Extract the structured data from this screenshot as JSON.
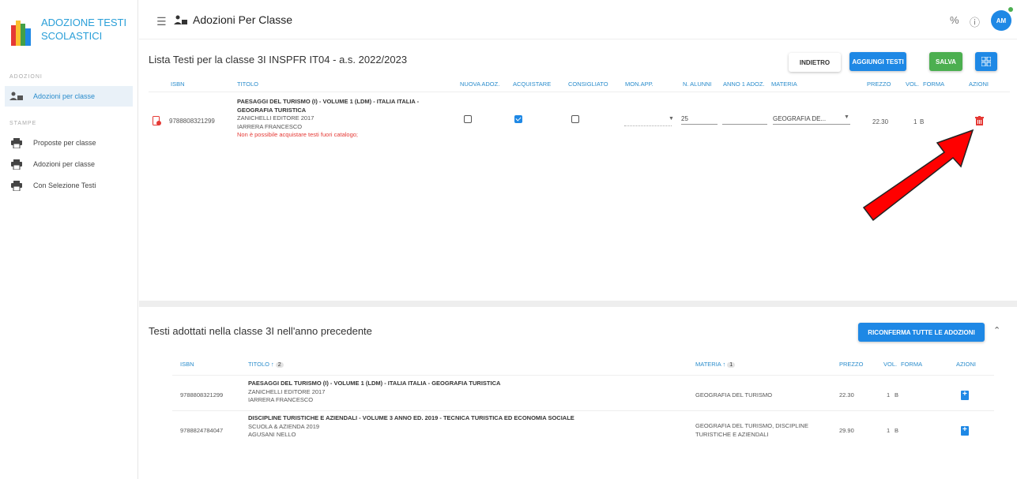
{
  "brand": {
    "name": "ADOZIONE TESTI SCOLASTICI"
  },
  "sidebar": {
    "section_adozioni": "ADOZIONI",
    "section_stampe": "STAMPE",
    "items": [
      {
        "label": "Adozioni per classe",
        "icon": "users-book-icon",
        "active": true
      },
      {
        "label": "Proposte per classe",
        "icon": "printer-icon"
      },
      {
        "label": "Adozioni per classe",
        "icon": "printer-icon"
      },
      {
        "label": "Con Selezione Testi",
        "icon": "printer-icon"
      }
    ]
  },
  "header": {
    "title": "Adozioni Per Classe",
    "avatar_initials": "AM",
    "icons": [
      "menu-icon",
      "percent-icon",
      "info-icon"
    ]
  },
  "upper": {
    "title": "Lista Testi per la classe 3I INSPFR IT04 - a.s. 2022/2023",
    "buttons": {
      "back": "INDIETRO",
      "add": "AGGIUNGI TESTI",
      "save": "SALVA"
    },
    "columns": {
      "isbn": "ISBN",
      "titolo": "TITOLO",
      "nuova": "NUOVA ADOZ.",
      "acquistare": "ACQUISTARE",
      "consigliato": "CONSIGLIATO",
      "monapp": "MON.APP.",
      "alunni": "N. ALUNNI",
      "anno": "ANNO 1 ADOZ.",
      "materia": "MATERIA",
      "prezzo": "PREZZO",
      "vol": "VOL.",
      "forma": "FORMA",
      "azioni": "AZIONI"
    },
    "row": {
      "isbn": "9788808321299",
      "title": "PAESAGGI DEL TURISMO (I) - VOLUME 1 (LDM) - ITALIA ITALIA - GEOGRAFIA TURISTICA",
      "publisher": "ZANICHELLI EDITORE 2017",
      "author": "IARRERA FRANCESCO",
      "warning": "Non è possibile acquistare testi fuori catalogo;",
      "nuova_adoz": false,
      "acquistare": true,
      "consigliato": false,
      "alunni": "25",
      "materia": "GEOGRAFIA DE...",
      "prezzo": "22.30",
      "vol": "1",
      "forma": "B"
    }
  },
  "lower": {
    "title": "Testi adottati nella classe 3I nell'anno precedente",
    "confirm_button": "RICONFERMA TUTTE LE ADOZIONI",
    "columns": {
      "isbn": "ISBN",
      "titolo": "TITOLO",
      "titolo_sort": "2",
      "materia": "MATERIA",
      "materia_sort": "1",
      "prezzo": "PREZZO",
      "vol": "VOL.",
      "forma": "FORMA",
      "azioni": "AZIONI"
    },
    "rows": [
      {
        "isbn": "9788808321299",
        "title": "PAESAGGI DEL TURISMO (I) - VOLUME 1 (LDM) - ITALIA ITALIA - GEOGRAFIA TURISTICA",
        "publisher": "ZANICHELLI EDITORE 2017",
        "author": "IARRERA FRANCESCO",
        "materia": "GEOGRAFIA DEL TURISMO",
        "prezzo": "22.30",
        "vol": "1",
        "forma": "B"
      },
      {
        "isbn": "9788824784047",
        "title": "DISCIPLINE TURISTICHE E AZIENDALI - VOLUME 3 ANNO ED. 2019 - TECNICA TURISTICA ED ECONOMIA SOCIALE",
        "publisher": "SCUOLA & AZIENDA 2019",
        "author": "AGUSANI NELLO",
        "materia": "GEOGRAFIA DEL TURISMO, DISCIPLINE TURISTICHE E AZIENDALI",
        "prezzo": "29.90",
        "vol": "1",
        "forma": "B"
      }
    ]
  },
  "colors": {
    "accent": "#1e88e5",
    "save": "#4caf50",
    "danger": "#e53935",
    "annotation_arrow": "#ff0000"
  }
}
